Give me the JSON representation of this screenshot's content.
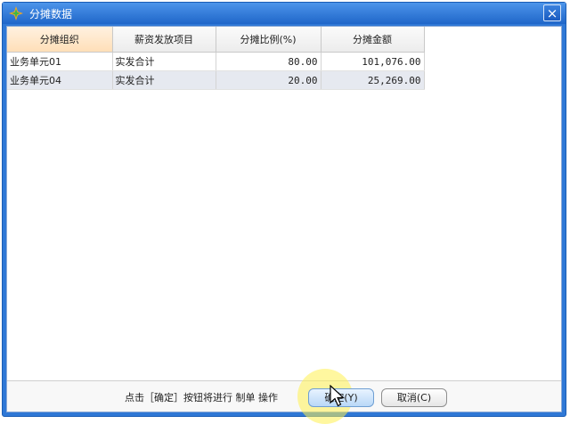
{
  "window": {
    "title": "分摊数据",
    "close_label": "×"
  },
  "table": {
    "columns": [
      "分摊组织",
      "薪资发放项目",
      "分摊比例(%)",
      "分摊金额"
    ],
    "rows": [
      [
        "业务单元01",
        "实发合计",
        "80.00",
        "101,076.00"
      ],
      [
        "业务单元04",
        "实发合计",
        "20.00",
        "25,269.00"
      ]
    ]
  },
  "footer": {
    "hint": "点击［确定］按钮将进行 制单 操作",
    "ok_label": "确定(Y)",
    "cancel_label": "取消(C)"
  },
  "colors": {
    "titlebar": "#2f78d6",
    "highlight": "#fff050"
  },
  "icons": {
    "app": "app-logo-icon",
    "close": "close-icon",
    "cursor": "mouse-cursor-icon"
  }
}
